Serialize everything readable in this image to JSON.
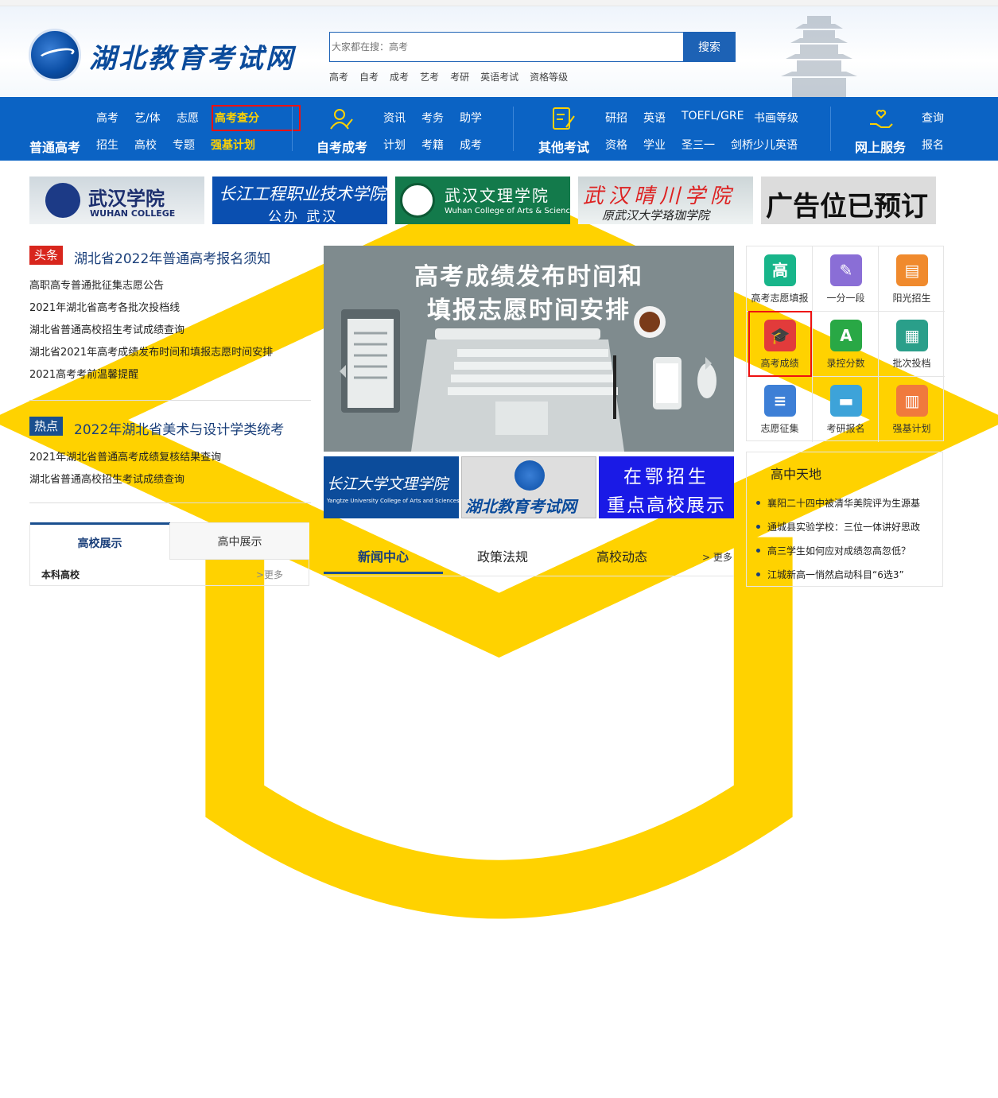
{
  "header": {
    "title": "湖北教育考试网",
    "search_placeholder": "大家都在搜：高考",
    "search_button": "搜索",
    "hot_links": [
      "高考",
      "自考",
      "成考",
      "艺考",
      "考研",
      "英语考试",
      "资格等级"
    ]
  },
  "nav": {
    "group1": {
      "title": "普通高考",
      "row1": [
        "高考",
        "艺/体",
        "志愿",
        "高考查分"
      ],
      "row2": [
        "招生",
        "高校",
        "专题",
        "强基计划"
      ]
    },
    "group2": {
      "title": "自考成考",
      "row1": [
        "资讯",
        "考务",
        "助学"
      ],
      "row2": [
        "计划",
        "考籍",
        "成考"
      ]
    },
    "group3": {
      "title": "其他考试",
      "row1": [
        "研招",
        "英语",
        "TOEFL/GRE",
        "书画等级"
      ],
      "row2": [
        "资格",
        "学业",
        "圣三一",
        "剑桥少儿英语"
      ]
    },
    "group4": {
      "title": "网上服务",
      "row1": [
        "查询"
      ],
      "row2": [
        "报名"
      ]
    }
  },
  "banners": {
    "b1_cn": "武汉学院",
    "b1_en": "WUHAN COLLEGE",
    "b2_cn": "长江工程职业技术学院",
    "b2_sub": "公办 武汉",
    "b3_cn": "武汉文理学院",
    "b3_en": "Wuhan College of Arts & Sciences",
    "b4_cn": "武汉晴川学院",
    "b4_sub": "原武汉大学珞珈学院",
    "b5": "广告位已预订"
  },
  "news": {
    "tag1": "头条",
    "headline1": "湖北省2022年普通高考报名须知",
    "list1": [
      "高职高专普通批征集志愿公告",
      "2021年湖北省高考各批次投档线",
      "湖北省普通高校招生考试成绩查询",
      "湖北省2021年高考成绩发布时间和填报志愿时间安排",
      "2021高考考前温馨提醒"
    ],
    "tag2": "热点",
    "headline2": "2022年湖北省美术与设计学类统考",
    "list2": [
      "2021年湖北省普通高考成绩复核结果查询",
      "湖北省普通高校招生考试成绩查询"
    ]
  },
  "carousel": {
    "line1": "高考成绩发布时间和",
    "line2": "填报志愿时间安排"
  },
  "small_banners": {
    "s1_cn": "长江大学文理学院",
    "s1_en": "Yangtze University College of Arts and Sciences",
    "s2": "湖北教育考试网",
    "s3_l1": "在鄂招生",
    "s3_l2": "重点高校展示"
  },
  "services": [
    {
      "label": "高考志愿填报",
      "color": "#18b58a",
      "glyph": "高"
    },
    {
      "label": "一分一段",
      "color": "#8a6ed6",
      "glyph": "✎"
    },
    {
      "label": "阳光招生",
      "color": "#f08a2d",
      "glyph": "▤"
    },
    {
      "label": "高考成绩",
      "color": "#e23b3b",
      "glyph": "🎓"
    },
    {
      "label": "录控分数",
      "color": "#29a845",
      "glyph": "A"
    },
    {
      "label": "批次投档",
      "color": "#2a9f8a",
      "glyph": "▦"
    },
    {
      "label": "志愿征集",
      "color": "#3d7fd6",
      "glyph": "≡"
    },
    {
      "label": "考研报名",
      "color": "#3da3d9",
      "glyph": "▬"
    },
    {
      "label": "强基计划",
      "color": "#f07a3d",
      "glyph": "▥"
    }
  ],
  "panel": {
    "title": "高中天地",
    "items": [
      "襄阳二十四中被清华美院评为生源基",
      "通城县实验学校：三位一体讲好思政",
      "高三学生如何应对成绩忽高忽低？",
      "江城新高一悄然启动科目“6选3”"
    ]
  },
  "left_tabs": {
    "tab1": "高校展示",
    "tab2": "高中展示",
    "sub": "本科高校",
    "more": ">更多"
  },
  "news_tabs": {
    "tab1": "新闻中心",
    "tab2": "政策法规",
    "tab3": "高校动态",
    "more": "> 更多"
  }
}
